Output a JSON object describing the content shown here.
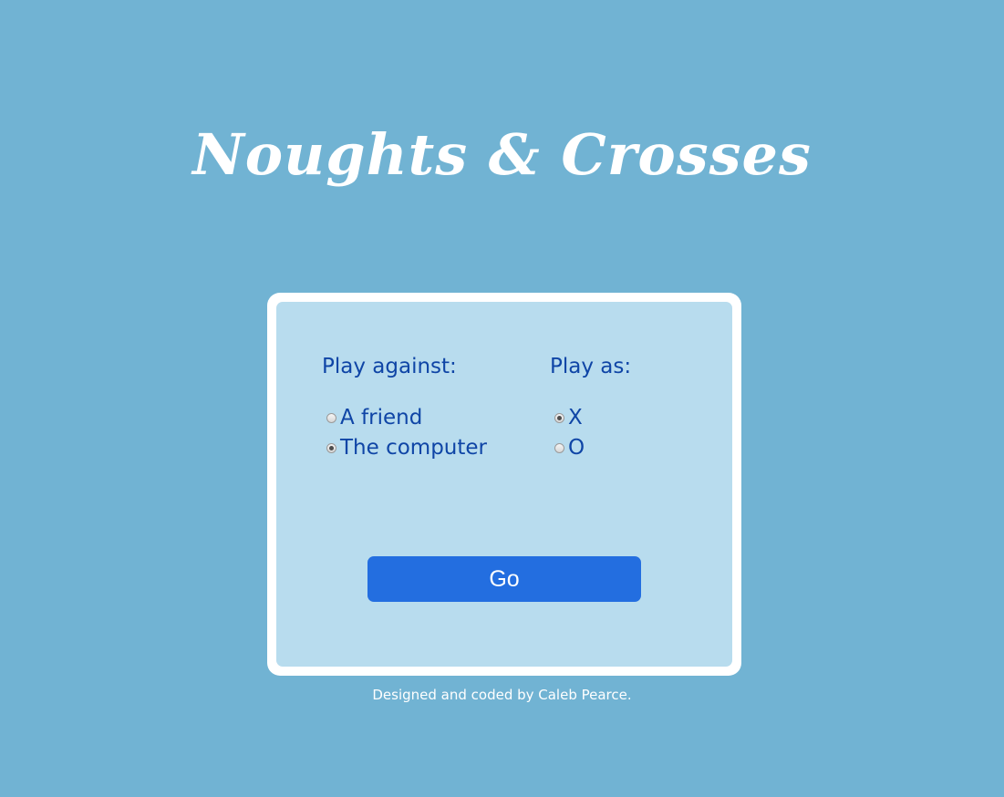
{
  "header": {
    "title": "Noughts & Crosses"
  },
  "setup": {
    "opponent": {
      "label": "Play against:",
      "options": [
        {
          "label": "A friend",
          "checked": false
        },
        {
          "label": "The computer",
          "checked": true
        }
      ]
    },
    "symbol": {
      "label": "Play as:",
      "options": [
        {
          "label": "X",
          "checked": true
        },
        {
          "label": "O",
          "checked": false
        }
      ]
    },
    "go_label": "Go"
  },
  "footer": {
    "credit": "Designed and coded by Caleb Pearce."
  },
  "colors": {
    "background": "#71b3d3",
    "card_border": "#ffffff",
    "card_fill": "#b8dcee",
    "text_blue": "#0f45a6",
    "button": "#236ee0"
  }
}
